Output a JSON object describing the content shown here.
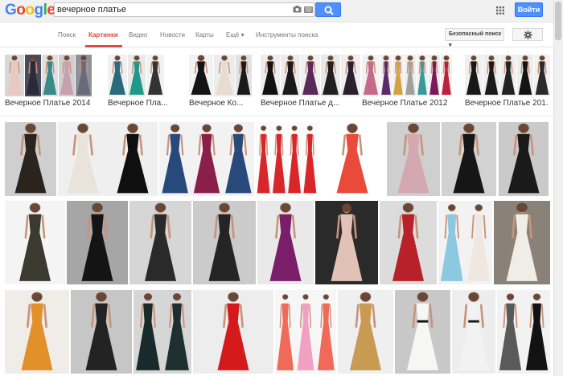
{
  "header": {
    "logo_letters": [
      {
        "ch": "G",
        "color": "#4285f4"
      },
      {
        "ch": "o",
        "color": "#ea4335"
      },
      {
        "ch": "o",
        "color": "#fbbc05"
      },
      {
        "ch": "g",
        "color": "#4285f4"
      },
      {
        "ch": "l",
        "color": "#34a853"
      },
      {
        "ch": "e",
        "color": "#ea4335"
      }
    ],
    "search_value": "вечерное платье",
    "signin_label": "Войти"
  },
  "tabs": {
    "items": [
      "Поиск",
      "Картинки",
      "Видео",
      "Новости",
      "Карты",
      "Ещё ▾",
      "Инструменты поиска"
    ],
    "active": "Картинки",
    "safesearch_label": "Безопасный поиск ▾"
  },
  "related": [
    {
      "label": "Вечерное Платье 2014",
      "colors": [
        "#e8c8c0",
        "#2a2a3a",
        "#3a8a8a",
        "#c9a0b0",
        "#6a6a7a"
      ],
      "bgs": [
        "#d8d8d8",
        "#4a4a5a",
        "#e0e0e0",
        "#cfcfcf",
        "#909098"
      ]
    },
    {
      "label": "Вечерное Пла...",
      "colors": [
        "#2a6a7a",
        "#1f9a8a",
        "#333"
      ],
      "bgs": [
        "#f0f0f0",
        "#e8e8e8",
        "#f2f2f2"
      ]
    },
    {
      "label": "Вечерное Ко...",
      "colors": [
        "#141414",
        "#e8dcd0",
        "#1a1a1a"
      ],
      "bgs": [
        "#f2f2f2",
        "#ececec",
        "#e2e2e2"
      ]
    },
    {
      "label": "Вечерное Платье д...",
      "colors": [
        "#121212",
        "#1a1a1a",
        "#5a2a5a",
        "#202020",
        "#2a2030"
      ],
      "bgs": [
        "#ededed",
        "#ececec",
        "#f0f0f0",
        "#e9e9e9",
        "#eeeeee"
      ]
    },
    {
      "label": "Вечерное Платье 2012",
      "colors": [
        "#c46a8a",
        "#5a2a6a",
        "#d4a040",
        "#a0a0a0",
        "#3a9a9a",
        "#7a1a5a",
        "#c02040"
      ],
      "bgs": [
        "#f2f2f2",
        "#efefef",
        "#f0f0f0",
        "#eeeeee",
        "#f1f1f1",
        "#ededed",
        "#f2f2f2"
      ]
    },
    {
      "label": "Вечерное Платье 201...",
      "colors": [
        "#181818",
        "#1a1a1a",
        "#222",
        "#141414",
        "#2a2a2a"
      ],
      "bgs": [
        "#f0f0f0",
        "#eeeeee",
        "#efefef",
        "#ededed",
        "#f1f1f1"
      ]
    }
  ],
  "results": [
    [
      {
        "dress": "#2a241f",
        "bg": "#cfcfcf",
        "n": 1
      },
      {
        "dress": "#e8e4dc",
        "bg": "#efefef",
        "n": 2,
        "alt": "#0f0f0f"
      },
      {
        "dress": "#274a7a",
        "bg": "#f2f2f2",
        "n": 3,
        "alt": "#8a1f4a"
      },
      {
        "dress": "#d8262a",
        "bg": "#fbfbfb",
        "n": 4
      },
      {
        "dress": "#e94a3a",
        "bg": "#ffffff",
        "n": 1
      },
      {
        "dress": "#d4a8b0",
        "bg": "#cfcfcf",
        "n": 1
      },
      {
        "dress": "#161616",
        "bg": "#d2d2d2",
        "n": 1
      },
      {
        "dress": "#1a1a1a",
        "bg": "#cacaca",
        "n": 1
      },
      {
        "dress": "#7a6a5a",
        "bg": "#ebebeb",
        "n": 1
      }
    ],
    [
      {
        "dress": "#3a3a30",
        "bg": "#f4f4f4",
        "n": 1
      },
      {
        "dress": "#141414",
        "bg": "#a6a6a6",
        "n": 1
      },
      {
        "dress": "#2a2a2a",
        "bg": "#d6d6d6",
        "n": 1
      },
      {
        "dress": "#252525",
        "bg": "#cbcbcb",
        "n": 1
      },
      {
        "dress": "#7a1e6a",
        "bg": "#e9e9e9",
        "n": 1
      },
      {
        "dress": "#e2c2b6",
        "bg": "#2a2a2a",
        "n": 1
      },
      {
        "dress": "#b8202a",
        "bg": "#dcdcdc",
        "n": 1
      },
      {
        "dress": "#8cc8e0",
        "bg": "#f2f2f2",
        "n": 2,
        "alt": "#efe7e2"
      },
      {
        "dress": "#f0ede6",
        "bg": "#8a8278",
        "n": 1
      }
    ],
    [
      {
        "dress": "#e2902a",
        "bg": "#f0ece8",
        "n": 1
      },
      {
        "dress": "#232323",
        "bg": "#c6c6c6",
        "n": 1
      },
      {
        "dress": "#1a2a2a",
        "bg": "#d6d6d6",
        "n": 2,
        "alt": "#1f2f2f"
      },
      {
        "dress": "#d41a1a",
        "bg": "#ededed",
        "n": 1
      },
      {
        "dress": "#f06a5a",
        "bg": "#f6f6f6",
        "n": 3,
        "alt": "#f0a0c0"
      },
      {
        "dress": "#c89a52",
        "bg": "#efefef",
        "n": 1
      },
      {
        "dress": "#f6f6f4",
        "bg": "#c8c8c8",
        "n": 1,
        "sash": "#111111"
      },
      {
        "dress": "#f2f2f2",
        "bg": "#ededed",
        "n": 1,
        "sash": "#1a1a1a"
      },
      {
        "dress": "#5a5a5a",
        "bg": "#f2f2f2",
        "n": 2,
        "alt": "#121212"
      }
    ]
  ]
}
